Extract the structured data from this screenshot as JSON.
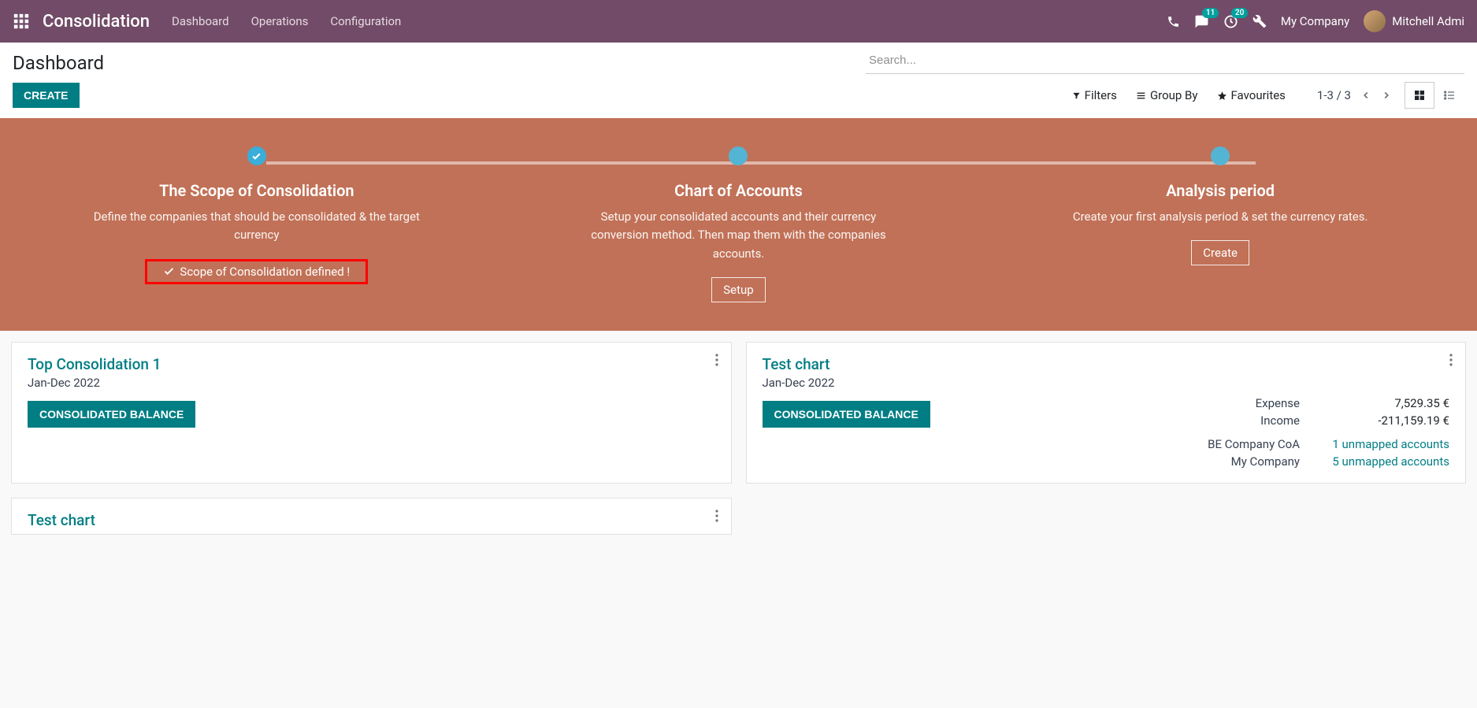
{
  "navbar": {
    "brand": "Consolidation",
    "menu": [
      "Dashboard",
      "Operations",
      "Configuration"
    ],
    "messages_badge": "11",
    "activities_badge": "20",
    "company": "My Company",
    "user": "Mitchell Admi"
  },
  "control": {
    "title": "Dashboard",
    "create": "CREATE",
    "search_placeholder": "Search...",
    "filters": "Filters",
    "groupby": "Group By",
    "favourites": "Favourites",
    "pager": "1-3 / 3"
  },
  "onboarding": {
    "steps": [
      {
        "title": "The Scope of Consolidation",
        "desc": "Define the companies that should be consolidated & the target currency",
        "done_label": "Scope of Consolidation defined !"
      },
      {
        "title": "Chart of Accounts",
        "desc": "Setup your consolidated accounts and their currency conversion method. Then map them with the companies accounts.",
        "button": "Setup"
      },
      {
        "title": "Analysis period",
        "desc": "Create your first analysis period & set the currency rates.",
        "button": "Create"
      }
    ]
  },
  "cards": [
    {
      "title": "Top Consolidation 1",
      "subtitle": "Jan-Dec 2022",
      "balance_btn": "CONSOLIDATED BALANCE"
    },
    {
      "title": "Test chart",
      "subtitle": "Jan-Dec 2022",
      "balance_btn": "CONSOLIDATED BALANCE",
      "metrics": [
        {
          "label": "Expense",
          "value": "7,529.35 €"
        },
        {
          "label": "Income",
          "value": "-211,159.19 €"
        }
      ],
      "companies": [
        {
          "label": "BE Company CoA",
          "link": "1 unmapped accounts"
        },
        {
          "label": "My Company",
          "link": "5 unmapped accounts"
        }
      ]
    },
    {
      "title": "Test chart"
    }
  ]
}
